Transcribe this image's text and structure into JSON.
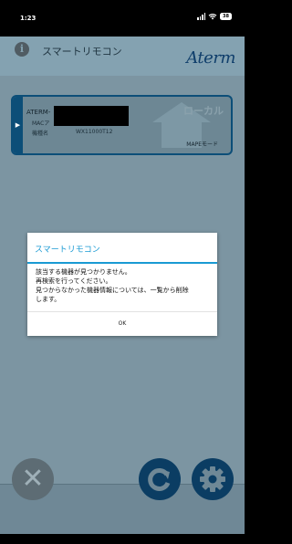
{
  "status_bar": {
    "time": "1:23",
    "battery": "38"
  },
  "app": {
    "title": "スマートリモコン",
    "brand": "Aterm",
    "info_icon": "info-icon"
  },
  "device": {
    "name_prefix": "ATERM-",
    "mac_label": "MACア",
    "model_label": "機種名",
    "model_value": "WX11000T12",
    "badge": "ローカル",
    "mode": "MAPEモード"
  },
  "toolbar": {
    "delete_icon": "close-x-icon",
    "refresh_icon": "refresh-icon",
    "settings_icon": "gear-icon"
  },
  "dialog": {
    "title": "スマートリモコン",
    "lines": [
      "該当する機器が見つかりません。",
      "再検索を行ってください。",
      "見つからなかった機器情報については、一覧から削除",
      "します。"
    ],
    "ok_label": "OK"
  },
  "colors": {
    "accent": "#1a9ad3",
    "nav_blue": "#0b3d63"
  }
}
